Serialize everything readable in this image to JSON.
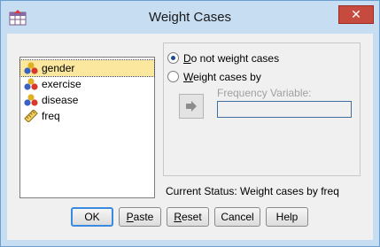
{
  "window": {
    "title": "Weight Cases",
    "close_glyph": "✕"
  },
  "variables": [
    {
      "name": "gender",
      "icon": "nominal-variable-icon",
      "selected": true
    },
    {
      "name": "exercise",
      "icon": "nominal-variable-icon",
      "selected": false
    },
    {
      "name": "disease",
      "icon": "nominal-variable-icon",
      "selected": false
    },
    {
      "name": "freq",
      "icon": "scale-variable-icon",
      "selected": false
    }
  ],
  "options": {
    "no_weight": {
      "mnemonic": "D",
      "rest": "o not weight cases",
      "checked": true
    },
    "weight_by": {
      "mnemonic": "W",
      "rest": "eight cases by",
      "checked": false
    }
  },
  "frequency_variable_label": "Frequency Variable:",
  "frequency_variable_value": "",
  "status": "Current Status: Weight cases by freq",
  "buttons": {
    "ok": "OK",
    "paste": {
      "mnemonic": "P",
      "rest": "aste"
    },
    "reset": {
      "mnemonic": "R",
      "rest": "eset"
    },
    "cancel": "Cancel",
    "help": "Help"
  },
  "colors": {
    "selection": "#fbe89e",
    "titlebar": "#c7ddf2",
    "close": "#c74a3e",
    "default_button_border": "#3a8ae0"
  }
}
